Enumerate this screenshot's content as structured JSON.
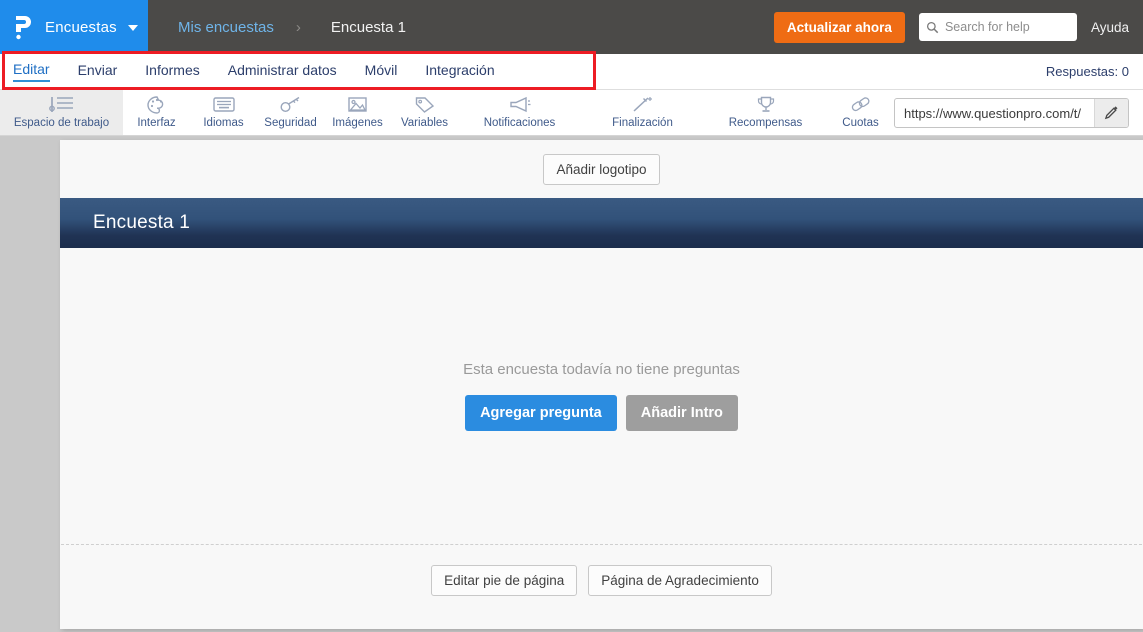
{
  "topbar": {
    "logo_icon": "questionpro-question-mark-logo",
    "brand_label": "Encuestas",
    "breadcrumb_parent": "Mis encuestas",
    "breadcrumb_separator": "›",
    "breadcrumb_current": "Encuesta 1",
    "upgrade_button": "Actualizar ahora",
    "search_placeholder": "Search for help",
    "search_value": "",
    "search_icon": "search-icon",
    "help_label": "Ayuda",
    "bar_color": "#4b4a48",
    "brand_color": "#1f8ceb",
    "upgrade_color": "#ef6c14"
  },
  "nav": {
    "tabs": [
      {
        "label": "Editar",
        "active": true
      },
      {
        "label": "Enviar",
        "active": false
      },
      {
        "label": "Informes",
        "active": false
      },
      {
        "label": "Administrar datos",
        "active": false
      },
      {
        "label": "Móvil",
        "active": false
      },
      {
        "label": "Integración",
        "active": false
      }
    ],
    "responses_label": "Respuestas: 0",
    "active_color": "#1f6fc4",
    "highlight_box_color": "#ed1c24"
  },
  "toolbar": {
    "items": [
      {
        "label": "Espacio de trabajo",
        "icon": "workspace-lines-icon",
        "active": true
      },
      {
        "label": "Interfaz",
        "icon": "palette-icon",
        "active": false
      },
      {
        "label": "Idiomas",
        "icon": "keyboard-icon",
        "active": false
      },
      {
        "label": "Seguridad",
        "icon": "key-icon",
        "active": false
      },
      {
        "label": "Imágenes",
        "icon": "image-icon",
        "active": false
      },
      {
        "label": "Variables",
        "icon": "tag-icon",
        "active": false
      },
      {
        "label": "Notificaciones",
        "icon": "megaphone-icon",
        "active": false
      },
      {
        "label": "Finalización",
        "icon": "magic-wand-icon",
        "active": false
      },
      {
        "label": "Recompensas",
        "icon": "trophy-icon",
        "active": false
      },
      {
        "label": "Cuotas",
        "icon": "chain-link-icon",
        "active": false
      }
    ],
    "survey_url": "https://www.questionpro.com/t/",
    "edit_icon": "pencil-icon"
  },
  "content": {
    "add_logo_button": "Añadir logotipo",
    "survey_title": "Encuesta 1",
    "empty_message": "Esta encuesta todavía no tiene preguntas",
    "add_question_button": "Agregar pregunta",
    "add_intro_button": "Añadir Intro",
    "edit_footer_button": "Editar pie de página",
    "thankyou_page_button": "Página de Agradecimiento",
    "banner_color": "#32527a",
    "primary_button_color": "#2b8ce0",
    "secondary_button_color": "#9e9e9e"
  }
}
